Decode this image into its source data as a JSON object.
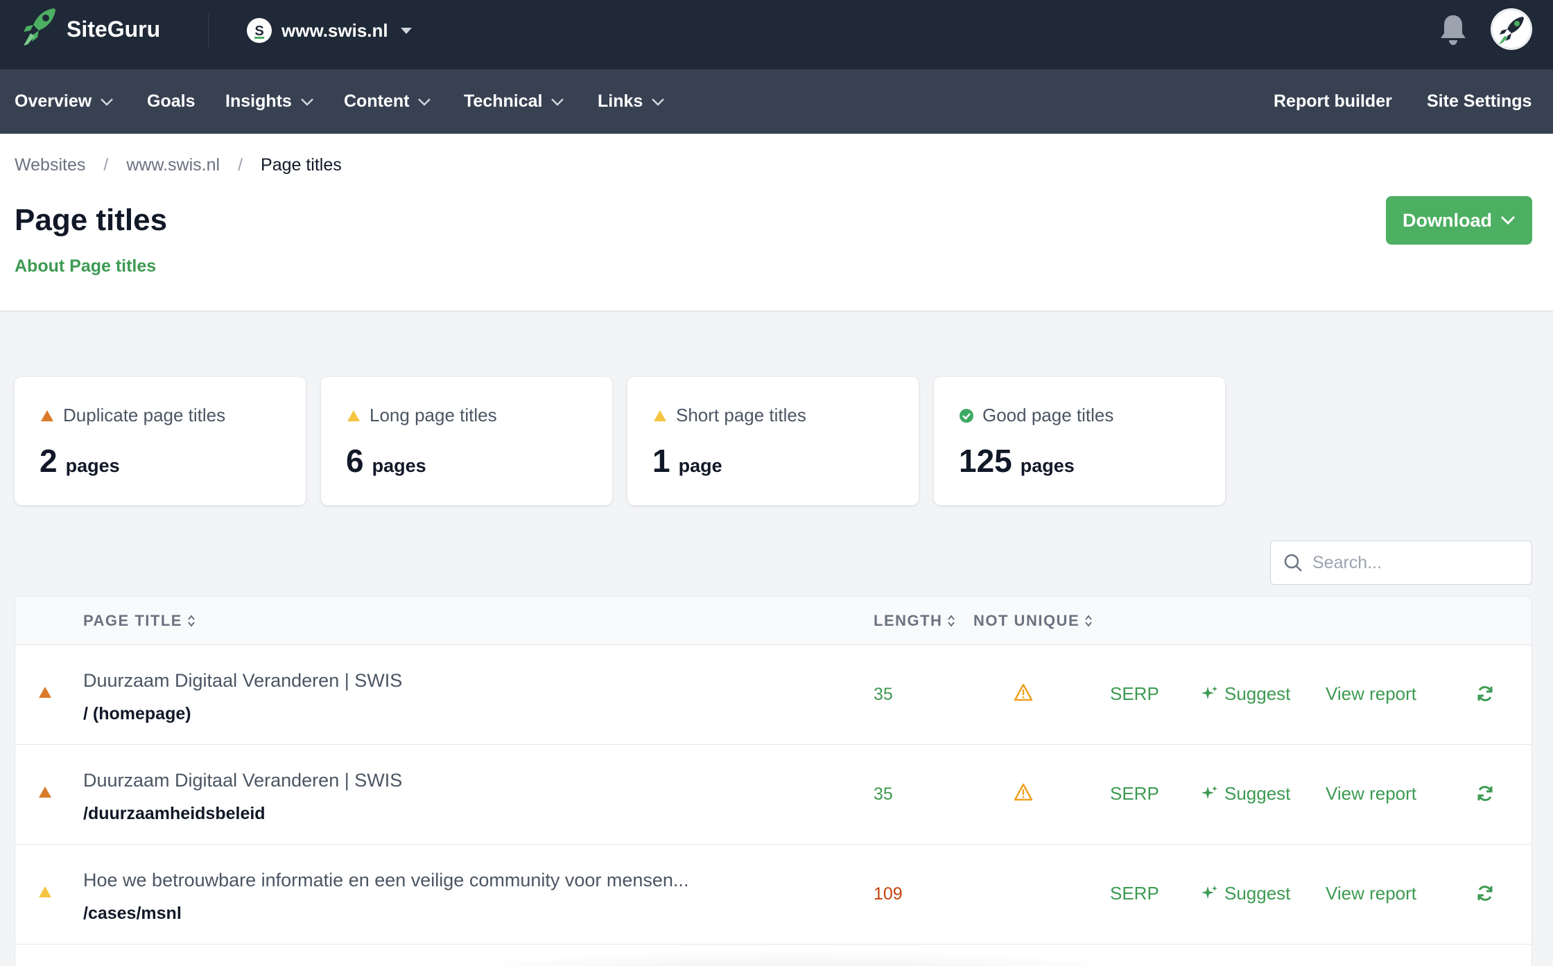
{
  "app": {
    "brand": "SiteGuru",
    "site_label": "www.swis.nl",
    "site_initial": "S"
  },
  "nav": {
    "items": [
      {
        "label": "Overview",
        "dropdown": true
      },
      {
        "label": "Goals",
        "dropdown": false
      },
      {
        "label": "Insights",
        "dropdown": true
      },
      {
        "label": "Content",
        "dropdown": true
      },
      {
        "label": "Technical",
        "dropdown": true
      },
      {
        "label": "Links",
        "dropdown": true
      }
    ],
    "right_items": [
      "Report builder",
      "Site Settings"
    ]
  },
  "breadcrumb": [
    "Websites",
    "www.swis.nl",
    "Page titles"
  ],
  "page": {
    "title": "Page titles",
    "about_link": "About Page titles",
    "download_label": "Download"
  },
  "cards": [
    {
      "label": "Duplicate page titles",
      "value": "2",
      "unit": "pages",
      "status": "warning-orange",
      "color": "#d97b2b"
    },
    {
      "label": "Long page titles",
      "value": "6",
      "unit": "pages",
      "status": "warning-yellow",
      "color": "#f5c542"
    },
    {
      "label": "Short page titles",
      "value": "1",
      "unit": "page",
      "status": "warning-yellow",
      "color": "#f5c542"
    },
    {
      "label": "Good page titles",
      "value": "125",
      "unit": "pages",
      "status": "good",
      "color": "#3daa63"
    }
  ],
  "search": {
    "placeholder": "Search..."
  },
  "table": {
    "columns": {
      "title": "PAGE TITLE",
      "length": "LENGTH",
      "not_unique": "NOT UNIQUE"
    },
    "actions": {
      "serp": "SERP",
      "suggest": "Suggest",
      "view": "View report"
    },
    "rows": [
      {
        "title": "Duurzaam Digitaal Veranderen | SWIS",
        "url": "/ (homepage)",
        "length": "35",
        "length_status": "ok",
        "not_unique": true,
        "status_color": "#d97b2b"
      },
      {
        "title": "Duurzaam Digitaal Veranderen | SWIS",
        "url": "/duurzaamheidsbeleid",
        "length": "35",
        "length_status": "ok",
        "not_unique": true,
        "status_color": "#d97b2b"
      },
      {
        "title": "Hoe we betrouwbare informatie en een veilige community voor mensen...",
        "url": "/cases/msnl",
        "length": "109",
        "length_status": "bad",
        "not_unique": false,
        "status_color": "#f5c542"
      }
    ]
  },
  "colors": {
    "accent": "#3d9a52",
    "button": "#4caf62",
    "topbar": "#1f2937",
    "navbar": "#374151"
  }
}
